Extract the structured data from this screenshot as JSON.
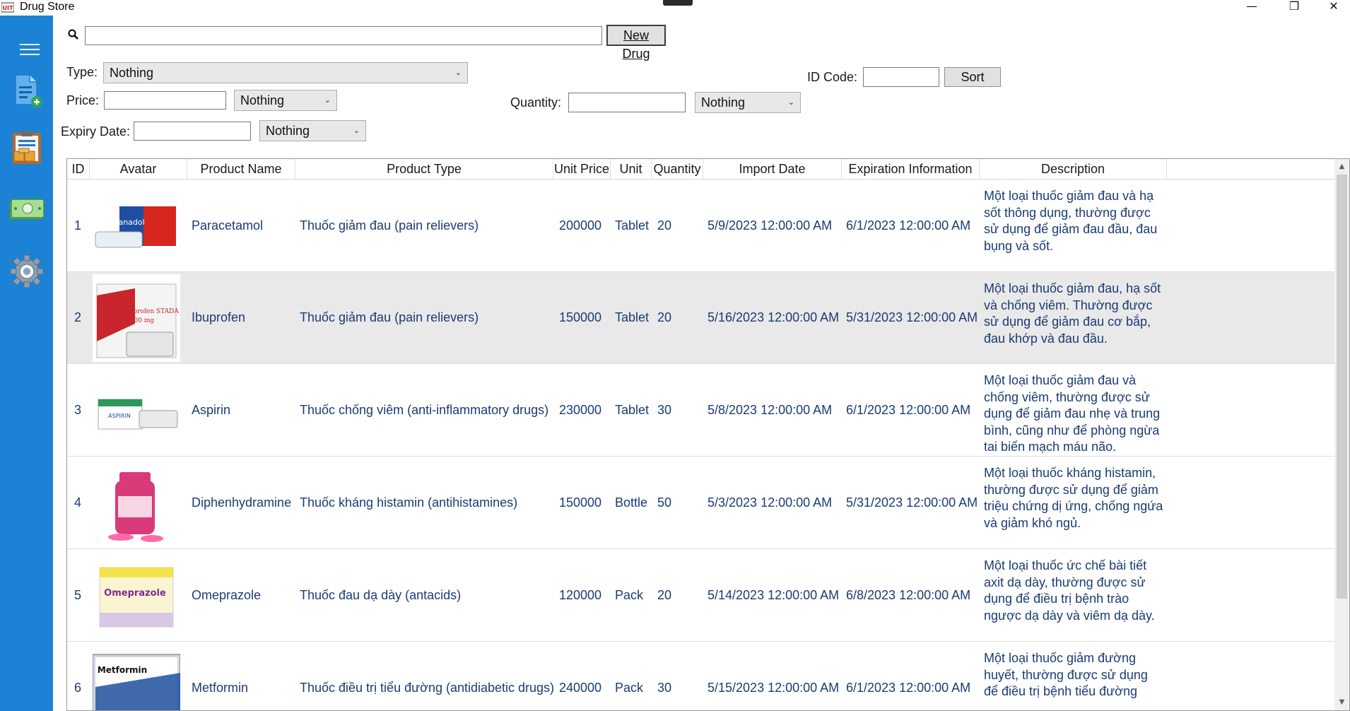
{
  "window": {
    "title": "Drug Store",
    "controls": {
      "minimize": "—",
      "maximize": "❐",
      "close": "✕"
    }
  },
  "sidebar": {
    "items": [
      {
        "icon": "hamburger-menu-icon"
      },
      {
        "icon": "add-document-icon"
      },
      {
        "icon": "clipboard-inventory-icon"
      },
      {
        "icon": "money-icon"
      },
      {
        "icon": "settings-gear-icon"
      }
    ]
  },
  "search": {
    "value": "",
    "new_drug_label": "New Drug"
  },
  "filters": {
    "type_label": "Type:",
    "type_value": "Nothing",
    "price_label": "Price:",
    "price_value": "",
    "price_op": "Nothing",
    "quantity_label": "Quantity:",
    "quantity_value": "",
    "quantity_op": "Nothing",
    "expiry_label": "Expiry Date:",
    "expiry_value": "",
    "expiry_op": "Nothing",
    "id_label": "ID Code:",
    "id_value": "",
    "sort_label": "Sort"
  },
  "table": {
    "headers": [
      "ID",
      "Avatar",
      "Product Name",
      "Product Type",
      "Unit Price",
      "Unit",
      "Quantity",
      "Import Date",
      "Expiration Information",
      "Description"
    ],
    "rows": [
      {
        "id": "1",
        "name": "Paracetamol",
        "type": "Thuốc giảm đau (pain relievers)",
        "price": "200000",
        "unit": "Tablet",
        "qty": "20",
        "import": "5/9/2023 12:00:00 AM",
        "expire": "6/1/2023 12:00:00 AM",
        "desc": " Một loại thuốc giảm đau và hạ sốt thông dụng, thường được sử dụng để giảm đau đầu, đau bụng và sốt.",
        "avatar": {
          "label": "Panadol",
          "colors": [
            "#d7261e",
            "#1e4fa0"
          ]
        }
      },
      {
        "id": "2",
        "name": "Ibuprofen",
        "type": "Thuốc giảm đau (pain relievers)",
        "price": "150000",
        "unit": "Tablet",
        "qty": "20",
        "import": "5/16/2023 12:00:00 AM",
        "expire": "5/31/2023 12:00:00 AM",
        "desc": "Một loại thuốc giảm đau, hạ sốt và chống viêm. Thường được sử dụng để giảm đau cơ bắp, đau khớp và đau đầu.",
        "avatar": {
          "label": "Ibuprofen STADA 400 mg",
          "colors": [
            "#c9252c",
            "#ffffff"
          ]
        }
      },
      {
        "id": "3",
        "name": "Aspirin",
        "type": "Thuốc chống viêm (anti-inflammatory drugs)",
        "price": "230000",
        "unit": "Tablet",
        "qty": "30",
        "import": "5/8/2023 12:00:00 AM",
        "expire": "6/1/2023 12:00:00 AM",
        "desc": "Một loại thuốc giảm đau và chống viêm, thường được sử dụng để giảm đau nhẹ và trung bình, cũng như để phòng ngừa tai biến mạch máu não.",
        "avatar": {
          "label": "ASPIRIN",
          "colors": [
            "#2a9a5a",
            "#ffffff"
          ]
        }
      },
      {
        "id": "4",
        "name": "Diphenhydramine",
        "type": "Thuốc kháng histamin (antihistamines)",
        "price": "150000",
        "unit": "Bottle",
        "qty": "50",
        "import": "5/3/2023 12:00:00 AM",
        "expire": "5/31/2023 12:00:00 AM",
        "desc": "Một loại thuốc kháng histamin, thường được sử dụng để giảm triệu chứng dị ứng, chống ngứa và giảm khó ngủ.",
        "avatar": {
          "label": "",
          "colors": [
            "#d83a7a",
            "#ff6aa8"
          ]
        }
      },
      {
        "id": "5",
        "name": "Omeprazole",
        "type": "Thuốc đau dạ dày (antacids)",
        "price": "120000",
        "unit": "Pack",
        "qty": "20",
        "import": "5/14/2023 12:00:00 AM",
        "expire": "6/8/2023 12:00:00 AM",
        "desc": "Một loại thuốc ức chế bài tiết axit dạ dày, thường được sử dụng để điều trị bệnh trào ngược dạ dày và viêm dạ dày.",
        "avatar": {
          "label": "Omeprazole",
          "colors": [
            "#7a2e8f",
            "#f4e24a"
          ]
        }
      },
      {
        "id": "6",
        "name": "Metformin",
        "type": "Thuốc điều trị tiểu đường (antidiabetic drugs)",
        "price": "240000",
        "unit": "Pack",
        "qty": "30",
        "import": "5/15/2023 12:00:00 AM",
        "expire": "6/1/2023 12:00:00 AM",
        "desc": "Một loại thuốc giảm đường huyết, thường được sử dụng để điều trị bệnh tiểu đường",
        "avatar": {
          "label": "Metformin",
          "colors": [
            "#1d4f9c",
            "#ffffff"
          ]
        }
      }
    ]
  },
  "colors": {
    "sidebar": "#1c82d6",
    "text_cell": "#1b3b74",
    "alt_row": "#e9e9e9"
  }
}
